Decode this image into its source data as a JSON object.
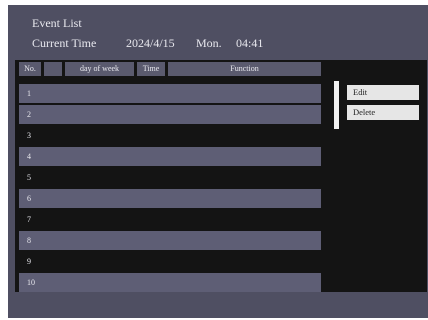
{
  "header": {
    "title": "Event List",
    "current_time_label": "Current Time",
    "date": "2024/4/15",
    "day_of_week": "Mon.",
    "time": "04:41"
  },
  "table": {
    "columns": [
      "No.",
      "",
      "day of week",
      "Time",
      "Function"
    ],
    "rows": [
      {
        "no": "1"
      },
      {
        "no": "2"
      },
      {
        "no": "3"
      },
      {
        "no": "4"
      },
      {
        "no": "5"
      },
      {
        "no": "6"
      },
      {
        "no": "7"
      },
      {
        "no": "8"
      },
      {
        "no": "9"
      },
      {
        "no": "10"
      }
    ]
  },
  "menu": {
    "edit_label": "Edit",
    "delete_label": "Delete"
  },
  "colors": {
    "background": "#4f4f62",
    "list_background": "#141414",
    "row_shade": "#5e5e75",
    "header_cell": "#5a5a6e",
    "button": "#e6e6e6"
  }
}
